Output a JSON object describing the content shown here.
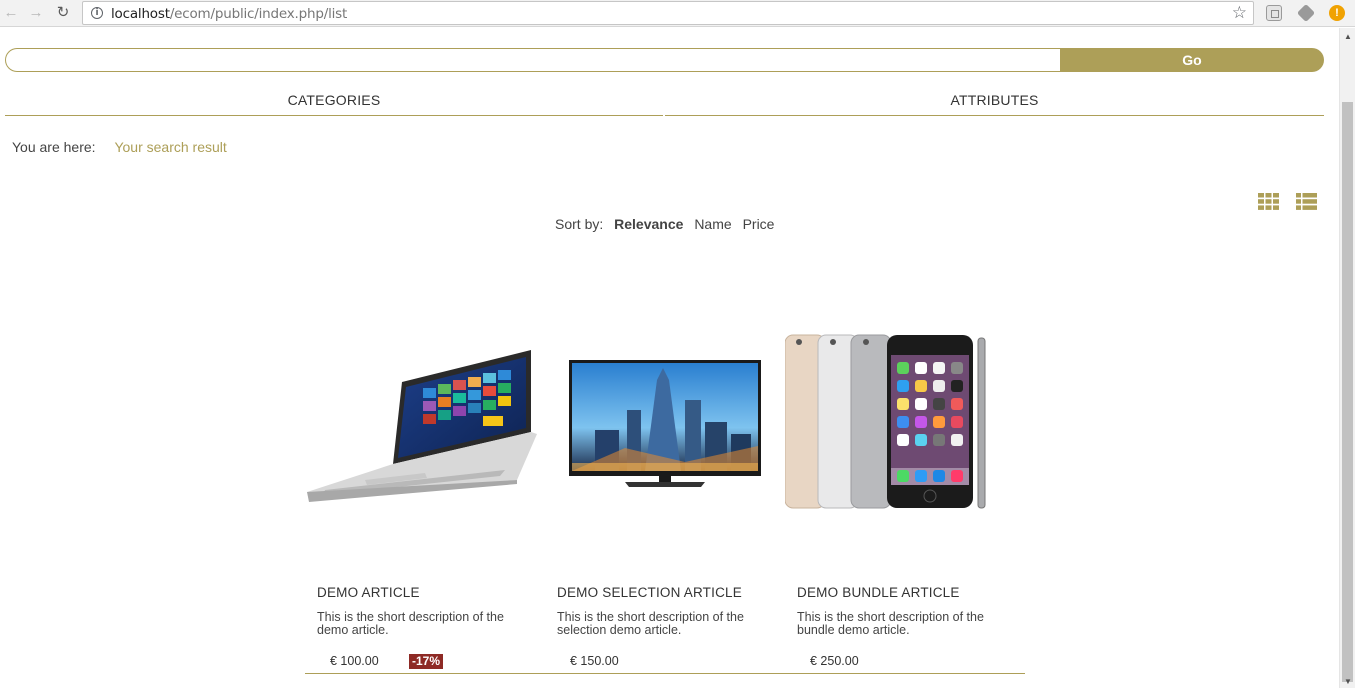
{
  "browser": {
    "url_host": "localhost",
    "url_path": "/ecom/public/index.php/list"
  },
  "search": {
    "value": "",
    "placeholder": "",
    "go_label": "Go"
  },
  "tabs": [
    {
      "label": "CATEGORIES"
    },
    {
      "label": "ATTRIBUTES"
    }
  ],
  "breadcrumb": {
    "label": "You are here:",
    "current": "Your search result"
  },
  "sort": {
    "label": "Sort by:",
    "options": [
      "Relevance",
      "Name",
      "Price"
    ],
    "active": "Relevance"
  },
  "products": [
    {
      "name": "DEMO ARTICLE",
      "description": "This is the short description of the demo article.",
      "price": "€ 100.00",
      "discount": "-17%",
      "image": "laptop"
    },
    {
      "name": "DEMO SELECTION ARTICLE",
      "description": "This is the short description of the selection demo article.",
      "price": "€ 150.00",
      "discount": "",
      "image": "television"
    },
    {
      "name": "DEMO BUNDLE ARTICLE",
      "description": "This is the short description of the bundle demo article.",
      "price": "€ 250.00",
      "discount": "",
      "image": "smartphones"
    }
  ],
  "colors": {
    "accent": "#ad9f58",
    "discount": "#8e2a25"
  }
}
